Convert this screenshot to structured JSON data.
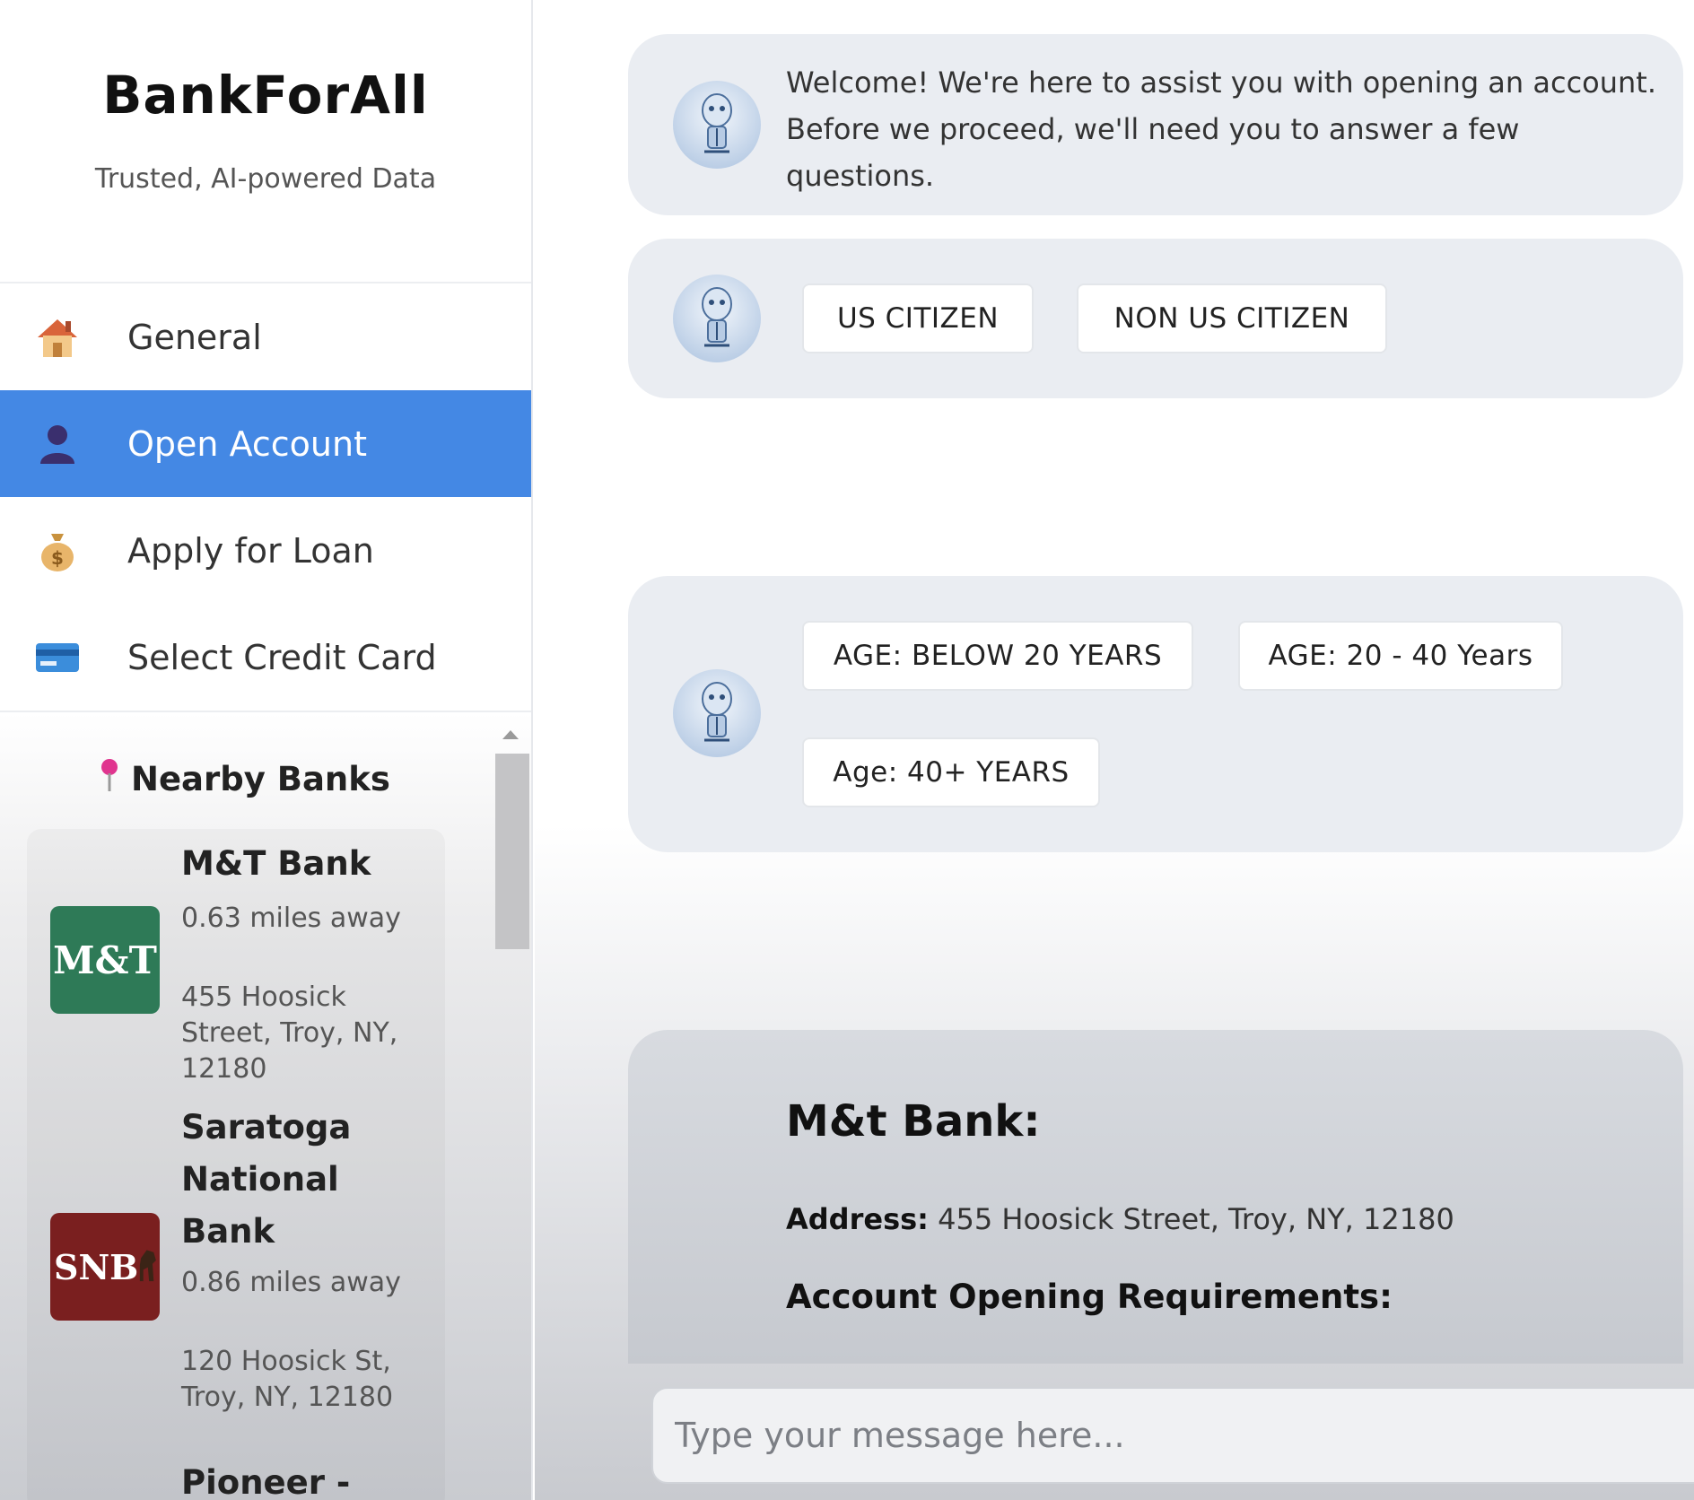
{
  "brand": {
    "title": "BankForAll",
    "subtitle": "Trusted, AI-powered Data"
  },
  "nav": [
    {
      "label": "General",
      "icon": "house-icon",
      "active": false
    },
    {
      "label": "Open Account",
      "icon": "person-icon",
      "active": true
    },
    {
      "label": "Apply for Loan",
      "icon": "money-bag-icon",
      "active": false
    },
    {
      "label": "Select Credit Card",
      "icon": "credit-card-icon",
      "active": false
    }
  ],
  "nearby": {
    "title": "Nearby Banks",
    "banks": [
      {
        "logo_text": "M&T",
        "name": "M&T Bank",
        "distance": "0.63 miles away",
        "address": "455 Hoosick Street, Troy, NY, 12180",
        "logo_color": "#2e7a57"
      },
      {
        "logo_text": "SNB",
        "name": "Saratoga National Bank",
        "distance": "0.86 miles away",
        "address": "120 Hoosick St, Troy, NY, 12180",
        "logo_color": "#7a1f1f"
      },
      {
        "logo_text": "",
        "name": "Pioneer -",
        "distance": "",
        "address": ""
      }
    ]
  },
  "chat": {
    "welcome": "Welcome! We're here to assist you with opening an account. Before we proceed, we'll need you to answer a few questions.",
    "citizenship_options": [
      "US CITIZEN",
      "NON US CITIZEN"
    ],
    "age_options": [
      "AGE: BELOW 20 YEARS",
      "AGE: 20 - 40 Years",
      "Age: 40+ YEARS"
    ],
    "info": {
      "title": "M&t Bank:",
      "address_label": "Address:",
      "address_value": "455 Hoosick Street, Troy, NY, 12180",
      "requirements_heading": "Account Opening Requirements:"
    },
    "input_placeholder": "Type your message here..."
  },
  "colors": {
    "accent": "#4488e4",
    "bubble": "#eaedf2"
  }
}
